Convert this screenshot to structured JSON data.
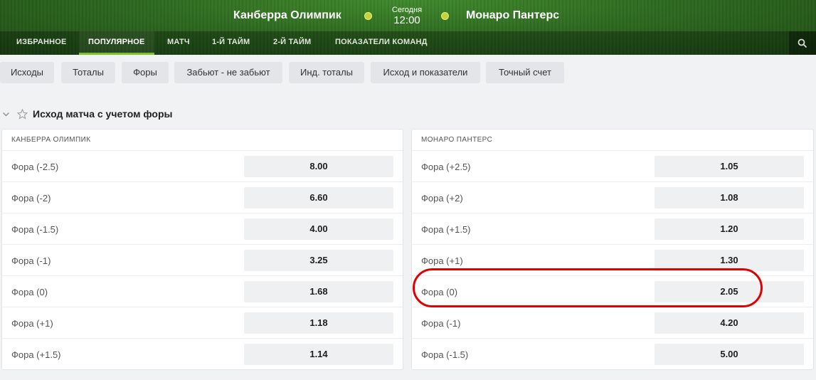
{
  "match": {
    "home_team": "Канберра Олимпик",
    "away_team": "Монаро Пантерс",
    "day": "Сегодня",
    "time": "12:00"
  },
  "nav": {
    "tabs": [
      "ИЗБРАННОЕ",
      "ПОПУЛЯРНОЕ",
      "МАТЧ",
      "1-Й ТАЙМ",
      "2-Й ТАЙМ",
      "ПОКАЗАТЕЛИ КОМАНД"
    ],
    "active_tab": "ПОПУЛЯРНОЕ"
  },
  "filters": [
    "Исходы",
    "Тоталы",
    "Форы",
    "Забьют - не забьют",
    "Инд. тоталы",
    "Исход и показатели",
    "Точный счет"
  ],
  "section": {
    "title": "Исход матча с учетом форы"
  },
  "panels": [
    {
      "header": "КАНБЕРРА ОЛИМПИК",
      "rows": [
        {
          "label": "Фора (-2.5)",
          "odd": "8.00"
        },
        {
          "label": "Фора (-2)",
          "odd": "6.60"
        },
        {
          "label": "Фора (-1.5)",
          "odd": "4.00"
        },
        {
          "label": "Фора (-1)",
          "odd": "3.25"
        },
        {
          "label": "Фора (0)",
          "odd": "1.68"
        },
        {
          "label": "Фора (+1)",
          "odd": "1.18"
        },
        {
          "label": "Фора (+1.5)",
          "odd": "1.14"
        }
      ]
    },
    {
      "header": "МОНАРО ПАНТЕРС",
      "rows": [
        {
          "label": "Фора (+2.5)",
          "odd": "1.05"
        },
        {
          "label": "Фора (+2)",
          "odd": "1.08"
        },
        {
          "label": "Фора (+1.5)",
          "odd": "1.20"
        },
        {
          "label": "Фора (+1)",
          "odd": "1.30"
        },
        {
          "label": "Фора (0)",
          "odd": "2.05"
        },
        {
          "label": "Фора (-1)",
          "odd": "4.20"
        },
        {
          "label": "Фора (-1.5)",
          "odd": "5.00"
        }
      ]
    }
  ],
  "colors": {
    "accent": "#7ec02a",
    "highlight": "#e00000",
    "header_green": "#2e6a20"
  },
  "icons": {
    "search": "search-icon",
    "collapse": "chevron-down-icon",
    "favorite": "star-icon",
    "live": "status-dot-icon"
  }
}
